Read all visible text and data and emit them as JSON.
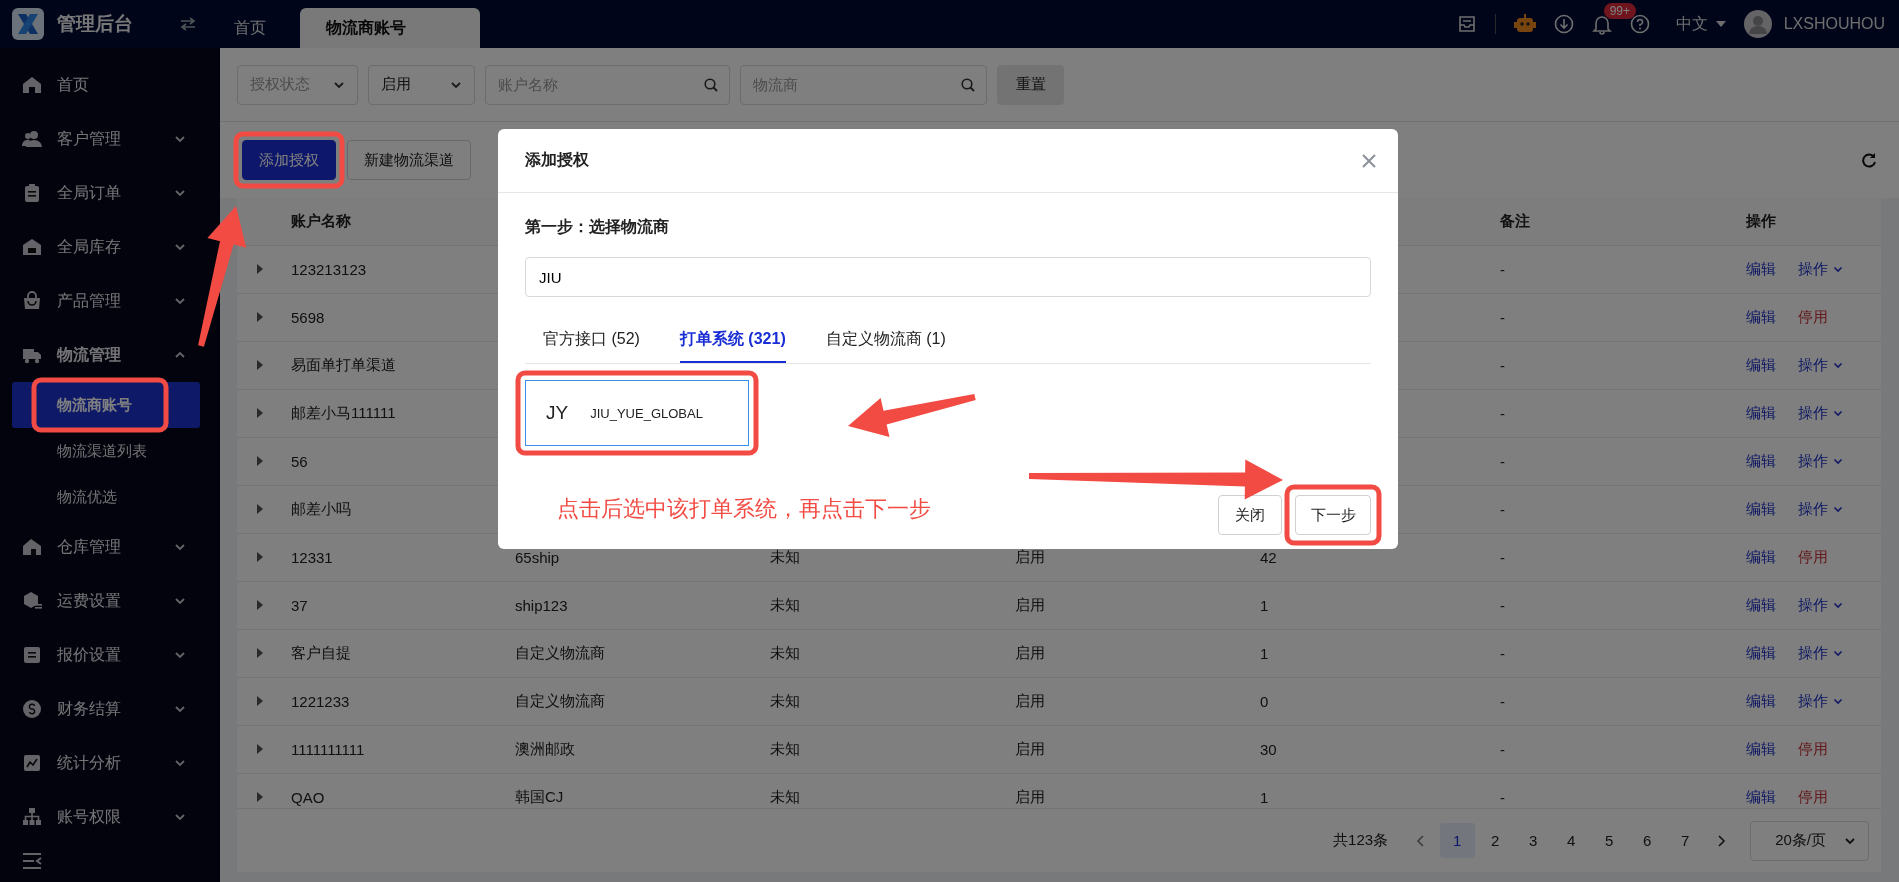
{
  "header": {
    "app_title": "管理后台",
    "tabs": [
      {
        "label": "首页",
        "selected": false
      },
      {
        "label": "物流商账号",
        "selected": true
      }
    ],
    "notifications_badge": "99+",
    "language": "中文",
    "username": "LXSHOUHOU"
  },
  "sidebar": {
    "items": [
      {
        "label": "首页",
        "kind": "link"
      },
      {
        "label": "客户管理",
        "kind": "group",
        "expanded": false
      },
      {
        "label": "全局订单",
        "kind": "group",
        "expanded": false
      },
      {
        "label": "全局库存",
        "kind": "group",
        "expanded": false
      },
      {
        "label": "产品管理",
        "kind": "group",
        "expanded": false
      },
      {
        "label": "物流管理",
        "kind": "group",
        "expanded": true,
        "children": [
          {
            "label": "物流商账号",
            "selected": true
          },
          {
            "label": "物流渠道列表",
            "selected": false
          },
          {
            "label": "物流优选",
            "selected": false
          }
        ]
      },
      {
        "label": "仓库管理",
        "kind": "group",
        "expanded": false
      },
      {
        "label": "运费设置",
        "kind": "group",
        "expanded": false
      },
      {
        "label": "报价设置",
        "kind": "group",
        "expanded": false
      },
      {
        "label": "财务结算",
        "kind": "group",
        "expanded": false
      },
      {
        "label": "统计分析",
        "kind": "group",
        "expanded": false
      },
      {
        "label": "账号权限",
        "kind": "group",
        "expanded": false
      }
    ]
  },
  "filters": [
    {
      "kind": "select",
      "placeholder": "授权状态"
    },
    {
      "kind": "select",
      "value": "启用"
    },
    {
      "kind": "search",
      "placeholder": "账户名称"
    },
    {
      "kind": "search",
      "placeholder": "物流商"
    }
  ],
  "reset_button": "重置",
  "toolbar": {
    "buttons": [
      {
        "label": "添加授权",
        "kind": "primary"
      },
      {
        "label": "新建物流渠道",
        "kind": "default"
      }
    ]
  },
  "table": {
    "columns": {
      "account_name": "账户名称",
      "remark": "备注",
      "actions": "操作"
    },
    "rows": [
      {
        "account_name": "123213123",
        "remark": "-",
        "actions": [
          {
            "label": "编辑",
            "kind": "link"
          },
          {
            "label": "操作",
            "kind": "menu"
          }
        ]
      },
      {
        "account_name": "5698",
        "remark": "-",
        "actions": [
          {
            "label": "编辑",
            "kind": "link"
          },
          {
            "label": "停用",
            "kind": "danger"
          }
        ]
      },
      {
        "account_name": "易面单打单渠道",
        "remark": "-",
        "actions": [
          {
            "label": "编辑",
            "kind": "link"
          },
          {
            "label": "操作",
            "kind": "menu"
          }
        ]
      },
      {
        "account_name": "邮差小马111111",
        "remark": "-",
        "actions": [
          {
            "label": "编辑",
            "kind": "link"
          },
          {
            "label": "操作",
            "kind": "menu"
          }
        ]
      },
      {
        "account_name": "56",
        "remark": "-",
        "actions": [
          {
            "label": "编辑",
            "kind": "link"
          },
          {
            "label": "操作",
            "kind": "menu"
          }
        ]
      },
      {
        "account_name": "邮差小吗",
        "remark": "-",
        "actions": [
          {
            "label": "编辑",
            "kind": "link"
          },
          {
            "label": "操作",
            "kind": "menu"
          }
        ]
      },
      {
        "account_name": "12331",
        "column_2": "65ship",
        "column_3": "未知",
        "column_4": "启用",
        "column_5": "42",
        "remark": "-",
        "actions": [
          {
            "label": "编辑",
            "kind": "link"
          },
          {
            "label": "停用",
            "kind": "danger"
          }
        ]
      },
      {
        "account_name": "37",
        "column_2": "ship123",
        "column_3": "未知",
        "column_4": "启用",
        "column_5": "1",
        "remark": "-",
        "actions": [
          {
            "label": "编辑",
            "kind": "link"
          },
          {
            "label": "操作",
            "kind": "menu"
          }
        ]
      },
      {
        "account_name": "客户自提",
        "column_2": "自定义物流商",
        "column_3": "未知",
        "column_4": "启用",
        "column_5": "1",
        "remark": "-",
        "actions": [
          {
            "label": "编辑",
            "kind": "link"
          },
          {
            "label": "操作",
            "kind": "menu"
          }
        ]
      },
      {
        "account_name": "1221233",
        "column_2": "自定义物流商",
        "column_3": "未知",
        "column_4": "启用",
        "column_5": "0",
        "remark": "-",
        "actions": [
          {
            "label": "编辑",
            "kind": "link"
          },
          {
            "label": "操作",
            "kind": "menu"
          }
        ]
      },
      {
        "account_name": "1111111111",
        "column_2": "澳洲邮政",
        "column_3": "未知",
        "column_4": "启用",
        "column_5": "30",
        "remark": "-",
        "actions": [
          {
            "label": "编辑",
            "kind": "link"
          },
          {
            "label": "停用",
            "kind": "danger"
          }
        ]
      },
      {
        "account_name": "QAO",
        "column_2": "韩国CJ",
        "column_3": "未知",
        "column_4": "启用",
        "column_5": "1",
        "remark": "-",
        "actions": [
          {
            "label": "编辑",
            "kind": "link"
          },
          {
            "label": "停用",
            "kind": "danger"
          }
        ]
      }
    ]
  },
  "pagination": {
    "total": "共123条",
    "pages": [
      {
        "label": "1",
        "selected": true
      },
      {
        "label": "2",
        "selected": false
      },
      {
        "label": "3",
        "selected": false
      },
      {
        "label": "4",
        "selected": false
      },
      {
        "label": "5",
        "selected": false
      },
      {
        "label": "6",
        "selected": false
      },
      {
        "label": "7",
        "selected": false
      }
    ],
    "page_size": "20条/页"
  },
  "modal": {
    "title": "添加授权",
    "step_title": "第一步：选择物流商",
    "search_value": "JIU",
    "tabs": [
      {
        "label": "官方接口 (52)",
        "selected": false
      },
      {
        "label": "打单系统 (321)",
        "selected": true
      },
      {
        "label": "自定义物流商 (1)",
        "selected": false
      }
    ],
    "providers": [
      {
        "initials": "JY",
        "name": "JIU_YUE_GLOBAL",
        "selected": true
      }
    ],
    "buttons": [
      {
        "label": "关闭"
      },
      {
        "label": "下一步"
      }
    ]
  },
  "annotation": {
    "note": "点击后选中该打单系统，再点击下一步"
  }
}
